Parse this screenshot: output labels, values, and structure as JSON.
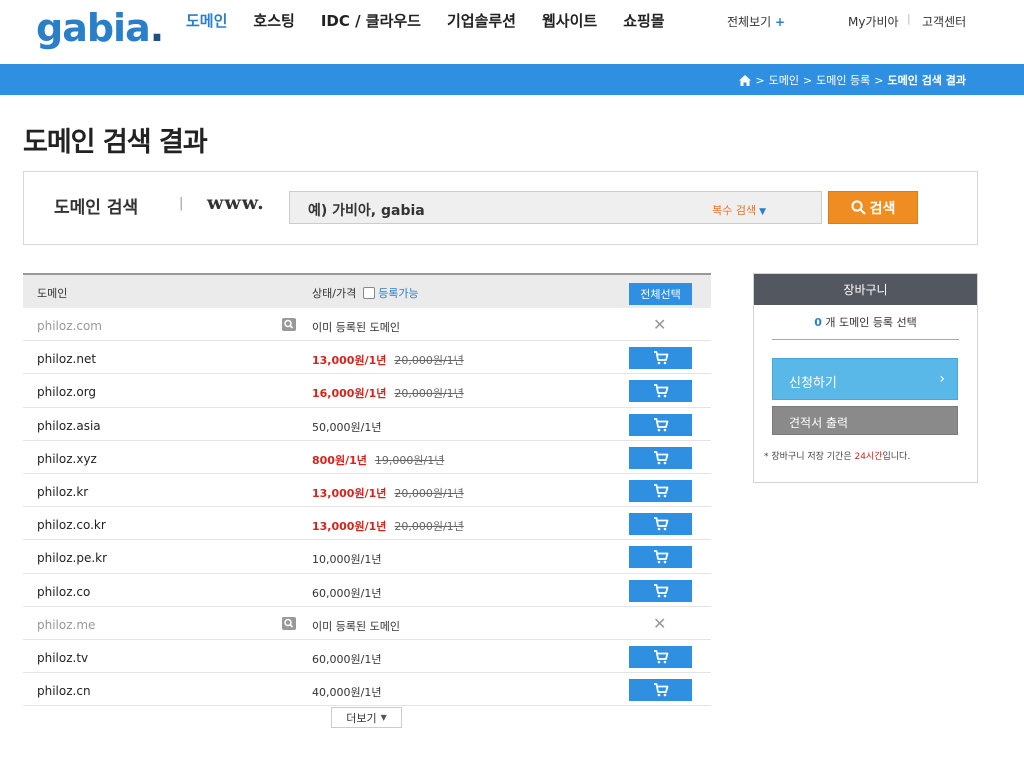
{
  "header": {
    "logo_text": "gabia",
    "logo_dot": ".",
    "menu": [
      "도메인",
      "호스팅",
      "IDC / 클라우드",
      "기업솔루션",
      "웹사이트",
      "쇼핑몰"
    ],
    "view_all": "전체보기",
    "view_all_plus": "+",
    "my_gabia": "My가비아",
    "separator": "|",
    "customer_center": "고객센터"
  },
  "breadcrumb": {
    "items": [
      "도메인",
      "도메인 등록",
      "도메인 검색 결과"
    ],
    "separator": ">"
  },
  "page_title": "도메인 검색 결과",
  "search": {
    "label": "도메인 검색",
    "label_separator": "|",
    "prefix": "www.",
    "placeholder": "예) 가비아, gabia",
    "multi_search": "복수 검색",
    "button": "검색"
  },
  "table": {
    "col_domain": "도메인",
    "col_status": "상태/가격",
    "available_filter": "등록가능",
    "select_all": "전체선택",
    "rows": [
      {
        "domain": "philoz.com",
        "taken": true,
        "status": "이미 등록된 도메인",
        "sale": "",
        "orig": ""
      },
      {
        "domain": "philoz.net",
        "taken": false,
        "status": "",
        "sale": "13,000원/1년",
        "orig": "20,000원/1년"
      },
      {
        "domain": "philoz.org",
        "taken": false,
        "status": "",
        "sale": "16,000원/1년",
        "orig": "20,000원/1년"
      },
      {
        "domain": "philoz.asia",
        "taken": false,
        "status": "50,000원/1년",
        "sale": "",
        "orig": ""
      },
      {
        "domain": "philoz.xyz",
        "taken": false,
        "status": "",
        "sale": "800원/1년",
        "orig": "19,000원/1년"
      },
      {
        "domain": "philoz.kr",
        "taken": false,
        "status": "",
        "sale": "13,000원/1년",
        "orig": "20,000원/1년"
      },
      {
        "domain": "philoz.co.kr",
        "taken": false,
        "status": "",
        "sale": "13,000원/1년",
        "orig": "20,000원/1년"
      },
      {
        "domain": "philoz.pe.kr",
        "taken": false,
        "status": "10,000원/1년",
        "sale": "",
        "orig": ""
      },
      {
        "domain": "philoz.co",
        "taken": false,
        "status": "60,000원/1년",
        "sale": "",
        "orig": ""
      },
      {
        "domain": "philoz.me",
        "taken": true,
        "status": "이미 등록된 도메인",
        "sale": "",
        "orig": ""
      },
      {
        "domain": "philoz.tv",
        "taken": false,
        "status": "60,000원/1년",
        "sale": "",
        "orig": ""
      },
      {
        "domain": "philoz.cn",
        "taken": false,
        "status": "40,000원/1년",
        "sale": "",
        "orig": ""
      }
    ],
    "more_button": "더보기"
  },
  "cart": {
    "title": "장바구니",
    "count": "0",
    "count_text": "개 도메인 등록 선택",
    "apply_button": "신청하기",
    "apply_arrow": "›",
    "quote_button": "견적서 출력",
    "note_prefix": "* 장바구니 저장 기간은 ",
    "note_highlight": "24시간",
    "note_suffix": "입니다."
  },
  "colors": {
    "brand_blue": "#2f8fe0",
    "search_orange": "#f08d22",
    "sale_red": "#d3241c",
    "cart_header": "#53575f"
  }
}
